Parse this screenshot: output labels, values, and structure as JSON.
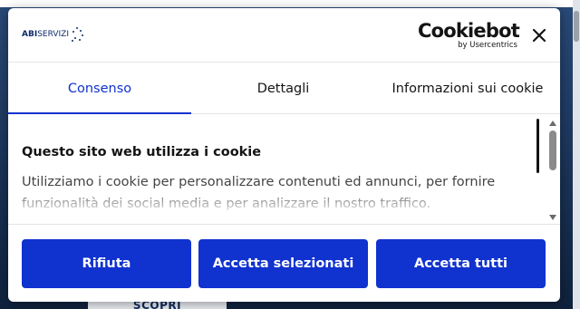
{
  "background": {
    "button_label": "SCOPRI"
  },
  "dialog": {
    "brand": {
      "abi": "ABI",
      "servizi": "SERVIZI"
    },
    "cookiebot": {
      "name": "Cookiebot",
      "by": "by Usercentrics"
    },
    "close_icon": "close-icon",
    "tabs": [
      {
        "label": "Consenso",
        "active": true
      },
      {
        "label": "Dettagli",
        "active": false
      },
      {
        "label": "Informazioni sui cookie",
        "active": false
      }
    ],
    "content": {
      "title": "Questo sito web utilizza i cookie",
      "text": "Utilizziamo i cookie per personalizzare contenuti ed annunci, per fornire funzionalità dei social media e per analizzare il nostro traffico."
    },
    "buttons": {
      "reject": "Rifiuta",
      "accept_selected": "Accetta selezionati",
      "accept_all": "Accetta tutti"
    }
  },
  "colors": {
    "accent": "#1032cf",
    "text": "#141414",
    "brand": "#0d2a6b"
  }
}
